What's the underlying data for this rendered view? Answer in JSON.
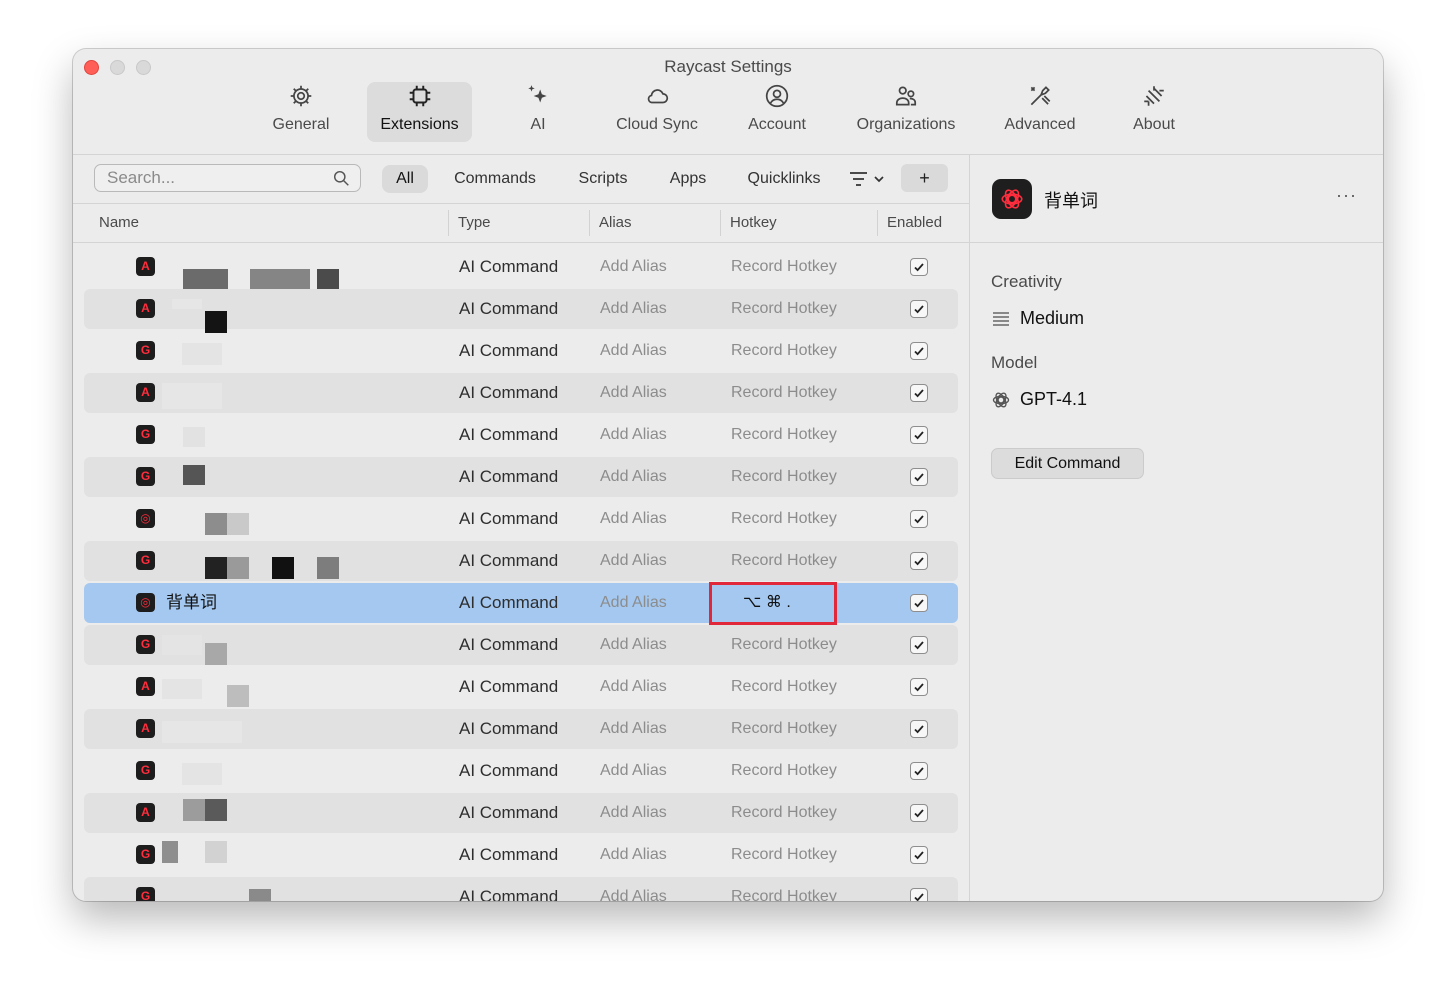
{
  "window": {
    "title": "Raycast Settings"
  },
  "tabs": [
    {
      "label": "General",
      "icon": "gear-icon"
    },
    {
      "label": "Extensions",
      "icon": "chip-icon",
      "active": true
    },
    {
      "label": "AI",
      "icon": "sparkle-icon"
    },
    {
      "label": "Cloud Sync",
      "icon": "cloud-icon"
    },
    {
      "label": "Account",
      "icon": "person-circle-icon"
    },
    {
      "label": "Organizations",
      "icon": "people-icon"
    },
    {
      "label": "Advanced",
      "icon": "tools-icon"
    },
    {
      "label": "About",
      "icon": "raycast-logo-icon"
    }
  ],
  "toolbar": {
    "search_placeholder": "Search...",
    "filters": [
      "All",
      "Commands",
      "Scripts",
      "Apps",
      "Quicklinks"
    ],
    "active_filter": "All",
    "add_label": "+"
  },
  "table": {
    "columns": {
      "name": "Name",
      "type": "Type",
      "alias": "Alias",
      "hotkey": "Hotkey",
      "enabled": "Enabled"
    },
    "rows": [
      {
        "icon": "A",
        "name": "",
        "type": "AI Command",
        "alias": "Add Alias",
        "hotkey": "Record Hotkey",
        "enabled": true
      },
      {
        "icon": "A",
        "name": "",
        "type": "AI Command",
        "alias": "Add Alias",
        "hotkey": "Record Hotkey",
        "enabled": true
      },
      {
        "icon": "G",
        "name": "",
        "type": "AI Command",
        "alias": "Add Alias",
        "hotkey": "Record Hotkey",
        "enabled": true
      },
      {
        "icon": "A",
        "name": "",
        "type": "AI Command",
        "alias": "Add Alias",
        "hotkey": "Record Hotkey",
        "enabled": true
      },
      {
        "icon": "G",
        "name": "",
        "type": "AI Command",
        "alias": "Add Alias",
        "hotkey": "Record Hotkey",
        "enabled": true
      },
      {
        "icon": "G",
        "name": "",
        "type": "AI Command",
        "alias": "Add Alias",
        "hotkey": "Record Hotkey",
        "enabled": true
      },
      {
        "icon": "O",
        "name": "",
        "type": "AI Command",
        "alias": "Add Alias",
        "hotkey": "Record Hotkey",
        "enabled": true
      },
      {
        "icon": "G",
        "name": "",
        "type": "AI Command",
        "alias": "Add Alias",
        "hotkey": "Record Hotkey",
        "enabled": true
      },
      {
        "icon": "O",
        "name": "背单词",
        "type": "AI Command",
        "alias": "Add Alias",
        "hotkey": "⌥ ⌘ .",
        "enabled": true,
        "selected": true
      },
      {
        "icon": "G",
        "name": "",
        "type": "AI Command",
        "alias": "Add Alias",
        "hotkey": "Record Hotkey",
        "enabled": true
      },
      {
        "icon": "A",
        "name": "",
        "type": "AI Command",
        "alias": "Add Alias",
        "hotkey": "Record Hotkey",
        "enabled": true
      },
      {
        "icon": "A",
        "name": "",
        "type": "AI Command",
        "alias": "Add Alias",
        "hotkey": "Record Hotkey",
        "enabled": true
      },
      {
        "icon": "G",
        "name": "",
        "type": "AI Command",
        "alias": "Add Alias",
        "hotkey": "Record Hotkey",
        "enabled": true
      },
      {
        "icon": "A",
        "name": "",
        "type": "AI Command",
        "alias": "Add Alias",
        "hotkey": "Record Hotkey",
        "enabled": true
      },
      {
        "icon": "G",
        "name": "",
        "type": "AI Command",
        "alias": "Add Alias",
        "hotkey": "Record Hotkey",
        "enabled": true
      },
      {
        "icon": "G",
        "name": "",
        "type": "AI Command",
        "alias": "Add Alias",
        "hotkey": "Record Hotkey",
        "enabled": true
      }
    ]
  },
  "detail": {
    "title": "背单词",
    "more": "···",
    "creativity_label": "Creativity",
    "creativity_value": "Medium",
    "model_label": "Model",
    "model_value": "GPT-4.1",
    "edit_button": "Edit Command"
  },
  "colors": {
    "selected_row": "#a4c8f0",
    "highlight_box": "#e0283a",
    "close_button": "#ff5f57"
  }
}
